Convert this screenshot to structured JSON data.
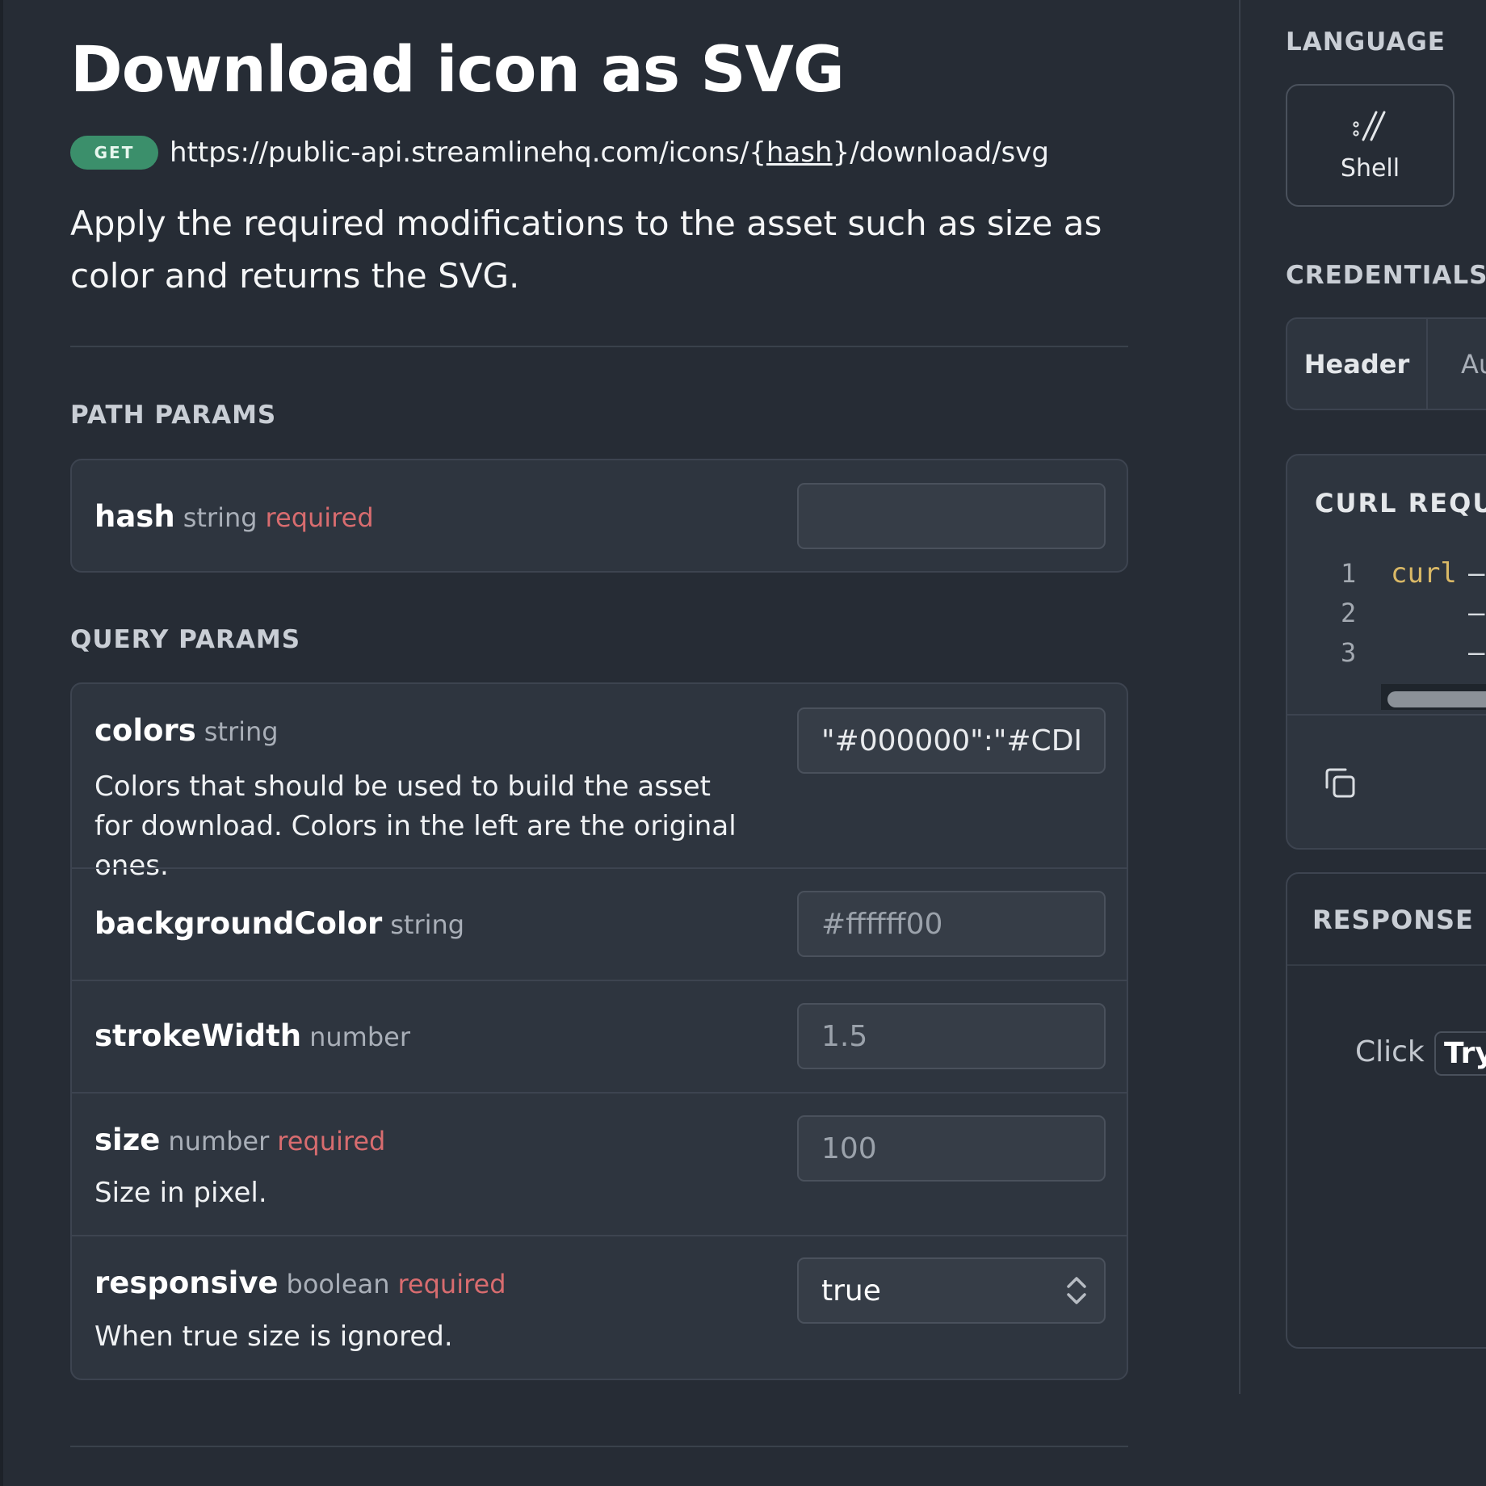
{
  "page": {
    "title": "Download icon as SVG",
    "method": "GET",
    "url_prefix": "https://public-api.streamlinehq.com/icons/{",
    "url_param": "hash",
    "url_suffix": "}/download/svg",
    "description": "Apply the required modifications to the asset such as size as color and returns the SVG."
  },
  "path_params": {
    "label": "PATH PARAMS",
    "items": [
      {
        "name": "hash",
        "type": "string",
        "required": "required",
        "value": ""
      }
    ]
  },
  "query_params": {
    "label": "QUERY PARAMS",
    "items": [
      {
        "name": "colors",
        "type": "string",
        "description": "Colors that should be used to build the asset for download. Colors in the left are the original ones.",
        "value": "\"#000000\":\"#CDI"
      },
      {
        "name": "backgroundColor",
        "type": "string",
        "placeholder": "#ffffff00"
      },
      {
        "name": "strokeWidth",
        "type": "number",
        "placeholder": "1.5"
      },
      {
        "name": "size",
        "type": "number",
        "required": "required",
        "description": "Size in pixel.",
        "placeholder": "100"
      },
      {
        "name": "responsive",
        "type": "boolean",
        "required": "required",
        "description": "When true size is ignored.",
        "value": "true"
      }
    ]
  },
  "sidebar": {
    "language_label": "LANGUAGE",
    "language": "Shell",
    "language_icon": "shell-icon",
    "credentials_label": "CREDENTIALS",
    "credentials_label_tail": "(",
    "tabs": [
      "Header",
      "Au"
    ],
    "curl_title": "CURL REQUE",
    "code_lines": [
      {
        "n": "1",
        "code": "curl",
        "tail": "–"
      },
      {
        "n": "2",
        "code": "",
        "tail": "–"
      },
      {
        "n": "3",
        "code": "",
        "tail": "–"
      }
    ],
    "copy_icon": "copy-icon",
    "response_label": "RESPONSE",
    "response_click": "Click",
    "response_try": "Try"
  },
  "colors": {
    "background": "#262c35",
    "card": "#2e353f",
    "required": "#d86c6f",
    "method_badge": "#3b8f6b",
    "code_keyword": "#d9b866"
  }
}
